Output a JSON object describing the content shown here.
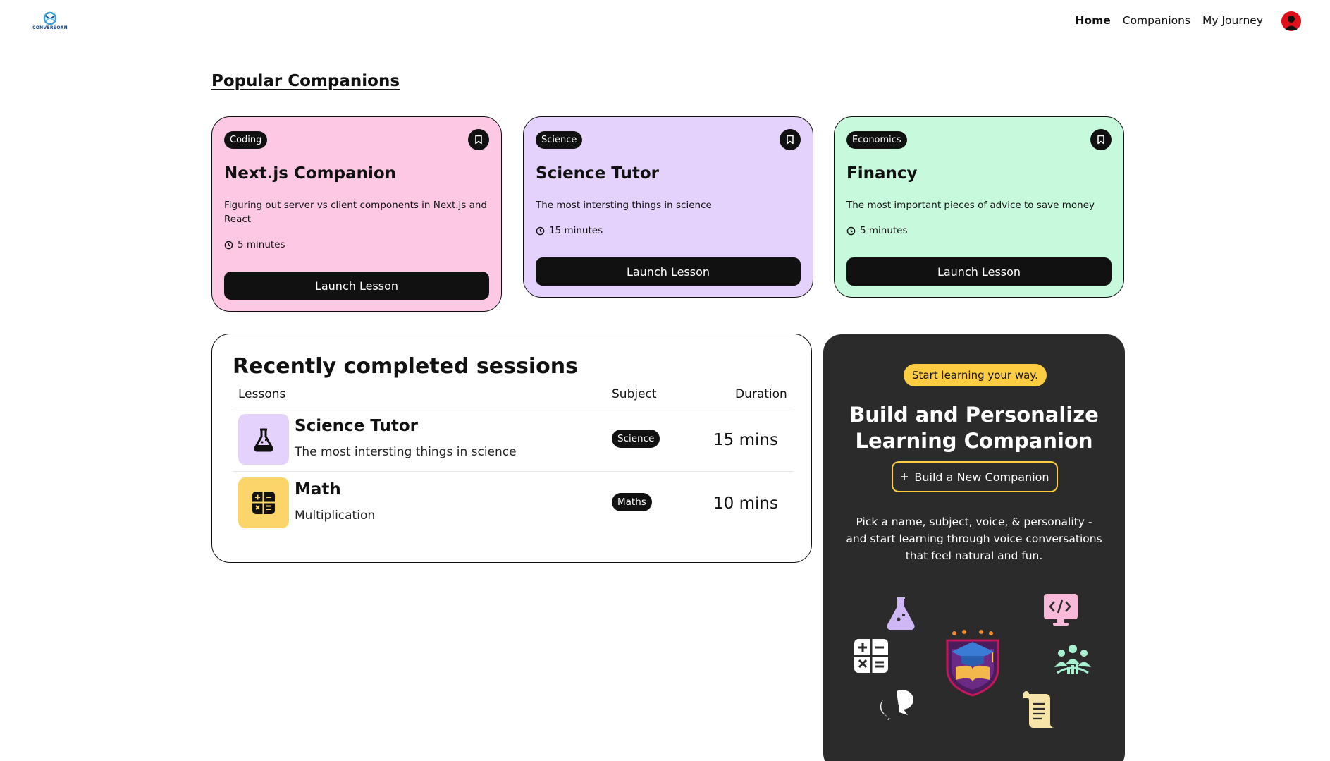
{
  "nav": {
    "brand": "CONVERSOAN",
    "links": [
      "Home",
      "Companions",
      "My Journey"
    ]
  },
  "popular": {
    "title": "Popular Companions",
    "cards": [
      {
        "subject": "Coding",
        "name": "Next.js Companion",
        "desc": "Figuring out server vs client components in Next.js and React",
        "duration": "5 minutes",
        "button": "Launch Lesson",
        "color": "#fcc8e3"
      },
      {
        "subject": "Science",
        "name": "Science Tutor",
        "desc": "The most intersting things in science",
        "duration": "15 minutes",
        "button": "Launch Lesson",
        "color": "#e4d2fc"
      },
      {
        "subject": "Economics",
        "name": "Financy",
        "desc": "The most important pieces of advice to save money",
        "duration": "5 minutes",
        "button": "Launch Lesson",
        "color": "#c7fadd"
      }
    ]
  },
  "recent": {
    "title": "Recently completed sessions",
    "headers": {
      "lessons": "Lessons",
      "subject": "Subject",
      "duration": "Duration"
    },
    "rows": [
      {
        "name": "Science Tutor",
        "desc": "The most intersting things in science",
        "subject": "Science",
        "duration": "15 mins",
        "icon": "flask-icon",
        "color": "#e4d2fc"
      },
      {
        "name": "Math",
        "desc": "Multiplication",
        "subject": "Maths",
        "duration": "10 mins",
        "icon": "calculator-icon",
        "color": "#fcd56a"
      }
    ]
  },
  "cta": {
    "badge": "Start learning your way.",
    "title_line1": "Build and Personalize",
    "title_line2": "Learning Companion",
    "button": "Build a New Companion",
    "desc": "Pick a name, subject, voice, & personality - and start learning through voice conversations that feel natural and fun."
  },
  "colors": {
    "accent": "#fccc41",
    "dark": "#2b2b2b"
  }
}
